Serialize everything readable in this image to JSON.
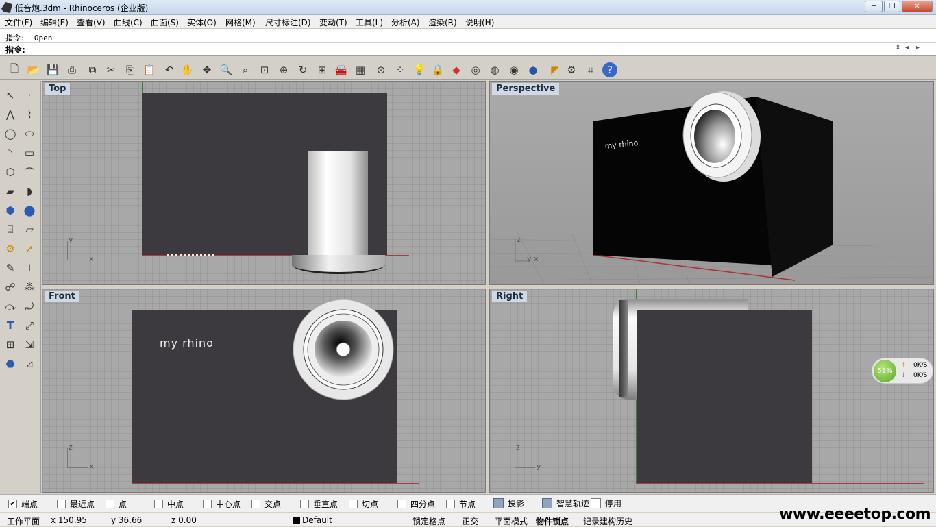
{
  "window": {
    "title": "低音炮.3dm - Rhinoceros (企业版)",
    "minimize": "─",
    "maximize": "❐",
    "close": "✕"
  },
  "menu": [
    "文件(F)",
    "编辑(E)",
    "查看(V)",
    "曲线(C)",
    "曲面(S)",
    "实体(O)",
    "网格(M)",
    "尺寸标注(D)",
    "变动(T)",
    "工具(L)",
    "分析(A)",
    "渲染(R)",
    "说明(H)"
  ],
  "command": {
    "history": "指令: _Open",
    "prompt": "指令:"
  },
  "toolbar_icons": [
    "new-icon",
    "open-icon",
    "save-icon",
    "print-icon",
    "import-icon",
    "cut-icon",
    "copy-icon",
    "paste-icon",
    "undo-icon",
    "pan-icon",
    "rotate-view-icon",
    "zoom-icon",
    "zoom-window-icon",
    "zoom-extents-icon",
    "zoom-selected-icon",
    "redraw-icon",
    "four-viewports-icon",
    "car-icon",
    "grid-icon",
    "snap-icon",
    "osnap-icon",
    "light-icon",
    "lock-icon",
    "layer-icon",
    "color-wheel-icon",
    "wireframe-icon",
    "shaded-icon",
    "rendered-icon",
    "sphere-icon",
    "properties-icon",
    "options-icon",
    "hierarchy-icon",
    "help-icon"
  ],
  "left_tool_icons": [
    "select-icon",
    "point-icon",
    "polyline-icon",
    "curve-icon",
    "circle-icon",
    "ellipse-icon",
    "arc-icon",
    "rectangle-icon",
    "polygon-icon",
    "fillet-icon",
    "surface-icon",
    "loft-icon",
    "box-icon",
    "boolean-icon",
    "cylinder-icon",
    "mesh-icon",
    "gear-icon",
    "arrow-icon",
    "trim-icon",
    "split-icon",
    "join-icon",
    "explode-icon",
    "offset-icon",
    "rebuild-icon",
    "text-icon",
    "scale-icon",
    "array-icon",
    "transform-icon",
    "solid-icon",
    "dimension-icon"
  ],
  "viewports": {
    "top": {
      "label": "Top",
      "axis_y": "y",
      "axis_x": "x"
    },
    "perspective": {
      "label": "Perspective",
      "text": "my rhino",
      "axis_z": "z",
      "axis_yx": "y x"
    },
    "front": {
      "label": "Front",
      "text": "my rhino",
      "axis_z": "z",
      "axis_x": "x"
    },
    "right": {
      "label": "Right",
      "axis_z": "z",
      "axis_y": "y"
    }
  },
  "osnaps": [
    {
      "label": "端点",
      "checked": true
    },
    {
      "label": "最近点",
      "checked": false
    },
    {
      "label": "点",
      "checked": false
    },
    {
      "label": "中点",
      "checked": false
    },
    {
      "label": "中心点",
      "checked": false
    },
    {
      "label": "交点",
      "checked": false
    },
    {
      "label": "垂直点",
      "checked": false
    },
    {
      "label": "切点",
      "checked": false
    },
    {
      "label": "四分点",
      "checked": false
    },
    {
      "label": "节点",
      "checked": false
    }
  ],
  "status_toggles": {
    "project": "投影",
    "smarttrack": "智慧轨迹",
    "disable": "停用"
  },
  "statusbar": {
    "cplane": "工作平面",
    "x": "x 150.95",
    "y": "y 36.66",
    "z": "z 0.00",
    "layer": "Default",
    "grid_snap": "锁定格点",
    "ortho": "正交",
    "planar": "平面模式",
    "osnap": "物件锁点",
    "history": "记录建构历史"
  },
  "network": {
    "percent": "51%",
    "up": "0K/S",
    "down": "0K/S"
  },
  "watermark": "www.eeeetop.com"
}
